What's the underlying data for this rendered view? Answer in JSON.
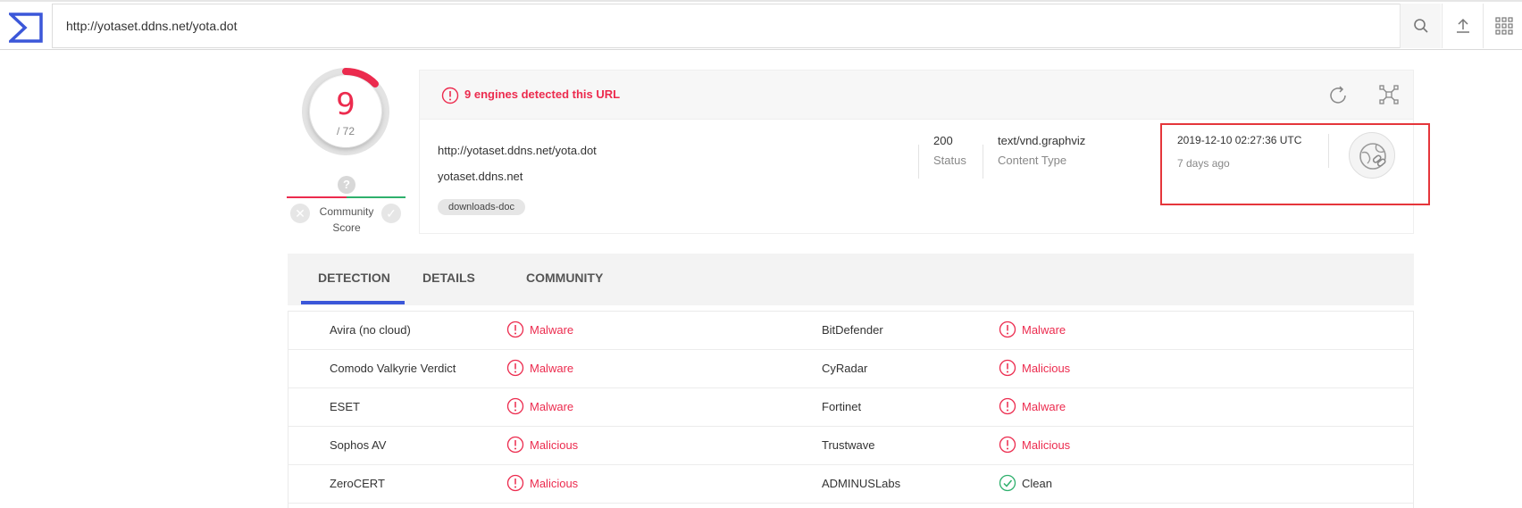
{
  "search": {
    "value": "http://yotaset.ddns.net/yota.dot"
  },
  "score": {
    "detections": "9",
    "total": "/ 72"
  },
  "community": {
    "label_line1": "Community",
    "label_line2": "Score",
    "question": "?"
  },
  "alert": {
    "text": "9 engines detected this URL"
  },
  "info": {
    "url": "http://yotaset.ddns.net/yota.dot",
    "domain": "yotaset.ddns.net",
    "tag": "downloads-doc",
    "status_value": "200",
    "status_label": "Status",
    "content_type_value": "text/vnd.graphviz",
    "content_type_label": "Content Type",
    "date": "2019-12-10 02:27:36 UTC",
    "ago": "7 days ago"
  },
  "tabs": [
    {
      "label": "DETECTION"
    },
    {
      "label": "DETAILS"
    },
    {
      "label": "COMMUNITY"
    }
  ],
  "rows": [
    {
      "left_engine": "Avira (no cloud)",
      "left_verdict": "Malware",
      "right_engine": "BitDefender",
      "right_verdict": "Malware"
    },
    {
      "left_engine": "Comodo Valkyrie Verdict",
      "left_verdict": "Malware",
      "right_engine": "CyRadar",
      "right_verdict": "Malicious"
    },
    {
      "left_engine": "ESET",
      "left_verdict": "Malware",
      "right_engine": "Fortinet",
      "right_verdict": "Malware"
    },
    {
      "left_engine": "Sophos AV",
      "left_verdict": "Malicious",
      "right_engine": "Trustwave",
      "right_verdict": "Malicious"
    },
    {
      "left_engine": "ZeroCERT",
      "left_verdict": "Malicious",
      "right_engine": "ADMINUSLabs",
      "right_verdict": "Clean"
    }
  ],
  "colors": {
    "malicious": "#ec2b4e",
    "clean": "#2fb06d",
    "accent": "#3b57d9",
    "highlight_box": "#e5363b"
  },
  "icons": [
    "sigma-logo-icon",
    "search-icon",
    "upload-icon",
    "apps-grid-icon",
    "alert-circle-icon",
    "refresh-icon",
    "graph-icon",
    "url-link-icon",
    "thumbs-down-icon",
    "thumbs-up-icon",
    "check-circle-icon"
  ]
}
